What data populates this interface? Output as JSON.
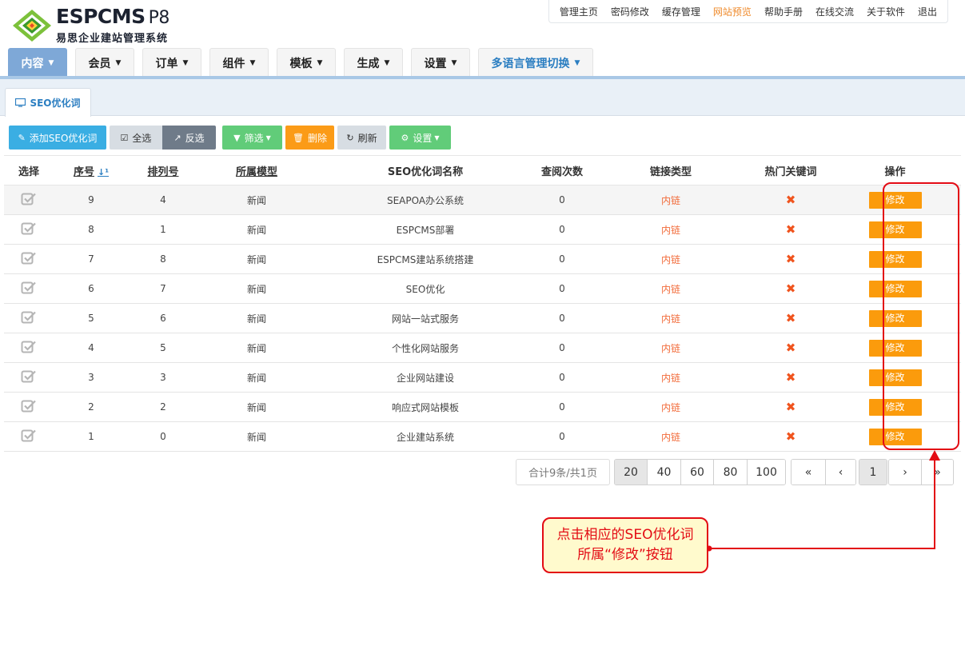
{
  "brand": {
    "name": "ESPCMS",
    "version": "P8",
    "subtitle": "易思企业建站管理系统"
  },
  "toplinks": [
    {
      "label": "管理主页",
      "active": false
    },
    {
      "label": "密码修改",
      "active": false
    },
    {
      "label": "缓存管理",
      "active": false
    },
    {
      "label": "网站预览",
      "active": true
    },
    {
      "label": "帮助手册",
      "active": false
    },
    {
      "label": "在线交流",
      "active": false
    },
    {
      "label": "关于软件",
      "active": false
    },
    {
      "label": "退出",
      "active": false
    }
  ],
  "nav": [
    {
      "label": "内容",
      "active": true
    },
    {
      "label": "会员",
      "active": false
    },
    {
      "label": "订单",
      "active": false
    },
    {
      "label": "组件",
      "active": false
    },
    {
      "label": "模板",
      "active": false
    },
    {
      "label": "生成",
      "active": false
    },
    {
      "label": "设置",
      "active": false
    },
    {
      "label": "多语言管理切换",
      "active": false
    }
  ],
  "tab": {
    "label": "SEO优化词"
  },
  "toolbar": {
    "add": "添加SEO优化词",
    "select_all": "全选",
    "invert": "反选",
    "filter": "筛选",
    "delete": "删除",
    "refresh": "刷新",
    "settings": "设置"
  },
  "table": {
    "headers": [
      "选择",
      "序号",
      "排列号",
      "所属模型",
      "SEO优化词名称",
      "查阅次数",
      "链接类型",
      "热门关键词",
      "操作"
    ],
    "rows": [
      {
        "id": "9",
        "order": "4",
        "model": "新闻",
        "name": "SEAPOA办公系统",
        "views": "0",
        "link": "内链",
        "edit": "修改"
      },
      {
        "id": "8",
        "order": "1",
        "model": "新闻",
        "name": "ESPCMS部署",
        "views": "0",
        "link": "内链",
        "edit": "修改"
      },
      {
        "id": "7",
        "order": "8",
        "model": "新闻",
        "name": "ESPCMS建站系统搭建",
        "views": "0",
        "link": "内链",
        "edit": "修改"
      },
      {
        "id": "6",
        "order": "7",
        "model": "新闻",
        "name": "SEO优化",
        "views": "0",
        "link": "内链",
        "edit": "修改"
      },
      {
        "id": "5",
        "order": "6",
        "model": "新闻",
        "name": "网站一站式服务",
        "views": "0",
        "link": "内链",
        "edit": "修改"
      },
      {
        "id": "4",
        "order": "5",
        "model": "新闻",
        "name": "个性化网站服务",
        "views": "0",
        "link": "内链",
        "edit": "修改"
      },
      {
        "id": "3",
        "order": "3",
        "model": "新闻",
        "name": "企业网站建设",
        "views": "0",
        "link": "内链",
        "edit": "修改"
      },
      {
        "id": "2",
        "order": "2",
        "model": "新闻",
        "name": "响应式网站模板",
        "views": "0",
        "link": "内链",
        "edit": "修改"
      },
      {
        "id": "1",
        "order": "0",
        "model": "新闻",
        "name": "企业建站系统",
        "views": "0",
        "link": "内链",
        "edit": "修改"
      }
    ]
  },
  "pagination": {
    "total": "合计9条/共1页",
    "sizes": [
      "20",
      "40",
      "60",
      "80",
      "100"
    ],
    "active_size": "20",
    "current_page": "1"
  },
  "callout": {
    "text": "点击相应的SEO优化词所属“修改”按钮"
  },
  "colors": {
    "accent": "#fb9b0c",
    "nav_active": "#7ea8d7",
    "annotation": "#e30b14"
  }
}
